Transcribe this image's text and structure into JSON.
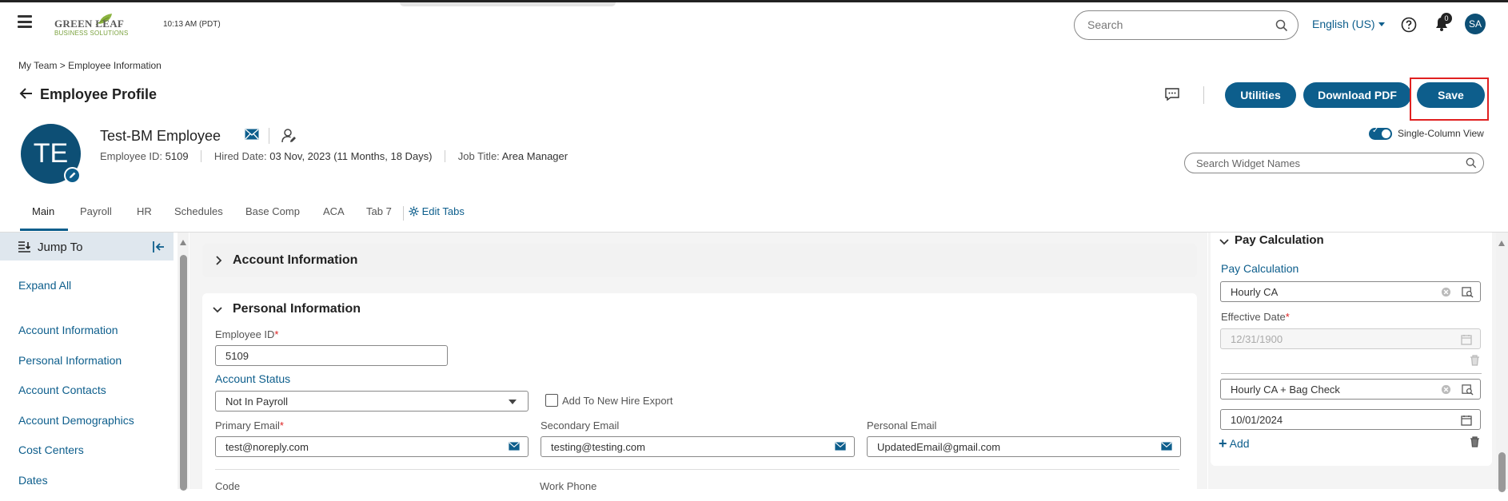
{
  "header": {
    "logo_main": "GREEN LEAF",
    "logo_sub": "BUSINESS SOLUTIONS",
    "clock": "10:13 AM (PDT)",
    "search_placeholder": "Search",
    "language": "English (US)",
    "notifications_count": "0",
    "user_initials": "SA"
  },
  "breadcrumb": "My Team  >  Employee Information",
  "page": {
    "title": "Employee Profile",
    "buttons": {
      "utilities": "Utilities",
      "download_pdf": "Download PDF",
      "save": "Save"
    }
  },
  "profile": {
    "initials": "TE",
    "name": "Test-BM Employee",
    "employee_id_label": "Employee ID:",
    "employee_id": "5109",
    "hired_label": "Hired Date:",
    "hired_date": "03 Nov, 2023 (11 Months, 18 Days)",
    "job_label": "Job Title:",
    "job_title": "Area Manager"
  },
  "view": {
    "single_column_label": "Single-Column View",
    "single_column_on": true,
    "widget_search_placeholder": "Search Widget Names"
  },
  "tabs": [
    {
      "label": "Main",
      "active": true
    },
    {
      "label": "Payroll"
    },
    {
      "label": "HR"
    },
    {
      "label": "Schedules"
    },
    {
      "label": "Base Comp"
    },
    {
      "label": "ACA"
    },
    {
      "label": "Tab 7"
    }
  ],
  "edit_tabs_label": "Edit Tabs",
  "sidebar": {
    "title": "Jump To",
    "expand_all": "Expand All",
    "items": [
      "Account Information",
      "Personal Information",
      "Account Contacts",
      "Account Demographics",
      "Cost Centers",
      "Dates"
    ]
  },
  "sections": {
    "account_information": {
      "title": "Account Information"
    },
    "personal_information": {
      "title": "Personal Information",
      "employee_id_label": "Employee ID",
      "employee_id_value": "5109",
      "account_status_label": "Account Status",
      "account_status_value": "Not In Payroll",
      "new_hire_export_label": "Add To New Hire Export",
      "primary_email_label": "Primary Email",
      "primary_email_value": "test@noreply.com",
      "secondary_email_label": "Secondary Email",
      "secondary_email_value": "testing@testing.com",
      "personal_email_label": "Personal Email",
      "personal_email_value": "UpdatedEmail@gmail.com",
      "code_label": "Code",
      "work_phone_label": "Work Phone"
    }
  },
  "pay_calculation": {
    "section_title": "Pay Calculation",
    "field_label": "Pay Calculation",
    "entries": [
      {
        "value": "Hourly CA",
        "effective_date": "12/31/1900"
      },
      {
        "value": "Hourly CA + Bag Check",
        "effective_date": "10/01/2024"
      }
    ],
    "effective_date_label": "Effective Date",
    "add_label": "Add"
  },
  "colors": {
    "accent": "#0d5e8c",
    "required": "#dd2222",
    "highlight": "#e02020"
  }
}
